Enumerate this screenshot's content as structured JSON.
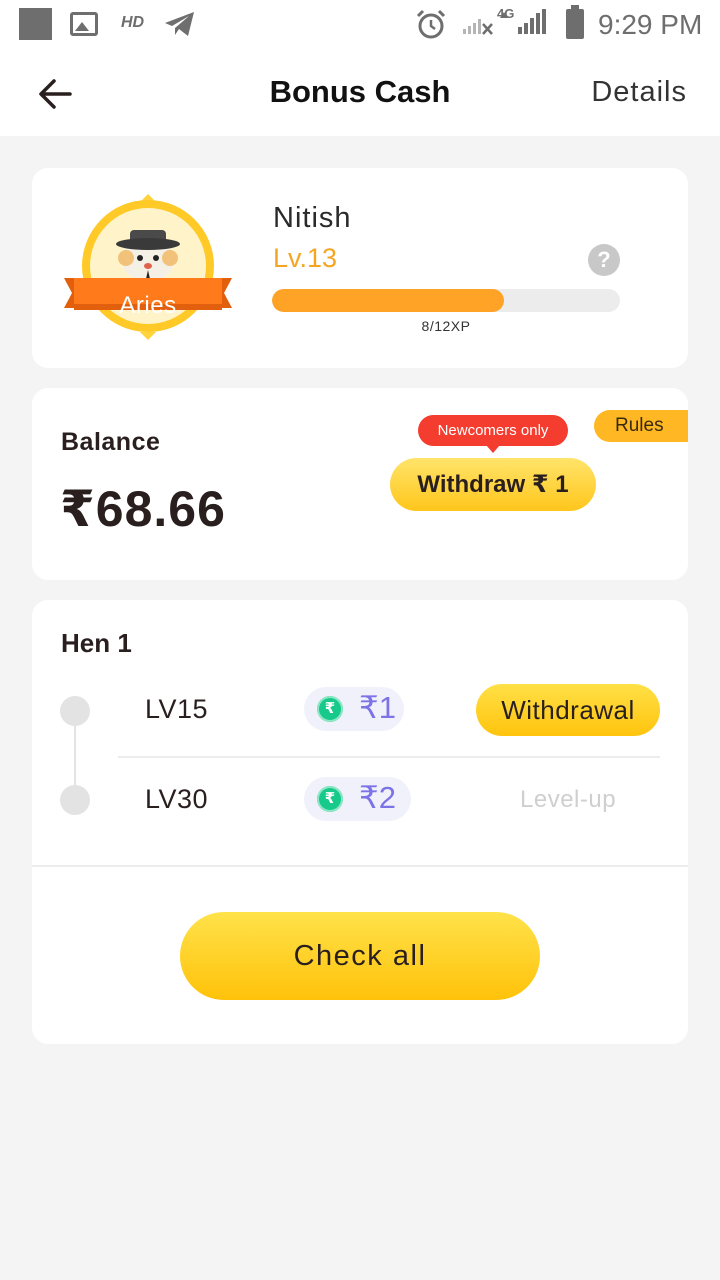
{
  "status_bar": {
    "hd_label": "HD",
    "network_label": "4G",
    "time": "9:29 PM",
    "icons": [
      "notification-square-icon",
      "image-icon",
      "telegram-icon",
      "alarm-icon",
      "signal-icon",
      "battery-icon"
    ]
  },
  "header": {
    "title": "Bonus Cash",
    "details_label": "Details",
    "back_icon": "arrow-left-icon"
  },
  "profile": {
    "badge_label": "Aries",
    "name": "Nitish",
    "level": "Lv.13",
    "help_symbol": "?",
    "xp_text": "8/12XP",
    "xp_current": 8,
    "xp_total": 12
  },
  "balance": {
    "label": "Balance",
    "value": "₹68.66",
    "rules_label": "Rules",
    "newcomers_label": "Newcomers only",
    "withdraw_label": "Withdraw ₹ 1"
  },
  "hen": {
    "title": "Hen 1",
    "rows": [
      {
        "level": "LV15",
        "coin_symbol": "₹",
        "reward": "₹1",
        "action": "Withdrawal"
      },
      {
        "level": "LV30",
        "coin_symbol": "₹",
        "reward": "₹2",
        "action": "Level-up"
      }
    ],
    "check_all_label": "Check all"
  },
  "colors": {
    "accent_yellow": "#ffc61c",
    "xp_orange": "#ffa326",
    "level_orange": "#f4a623",
    "badge_orange": "#ff7a1a",
    "newcomers_red": "#f43c2f",
    "reward_purple": "#7b73e6",
    "coin_green": "#17c98a"
  }
}
